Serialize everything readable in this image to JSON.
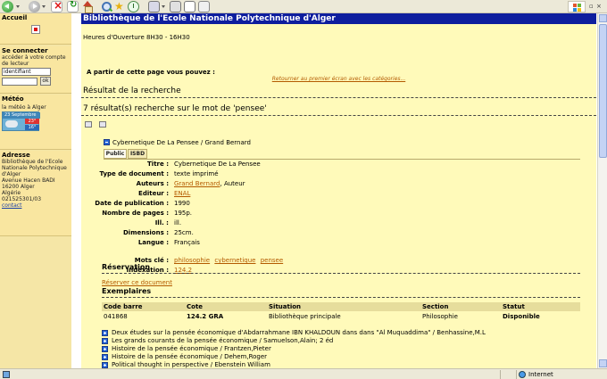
{
  "browser": {
    "zone": "Internet"
  },
  "sidebar": {
    "accueil": "Accueil",
    "login": {
      "heading": "Se connecter",
      "subtitle_line1": "accéder à votre compte",
      "subtitle_line2": "de lecteur",
      "username_value": "identifiant",
      "ok_label": "ok"
    },
    "meteo": {
      "heading": "Météo",
      "caption": "la météo à Alger",
      "date": "23 Septembre",
      "high": "23°",
      "low": "16°"
    },
    "adresse": {
      "heading": "Adresse",
      "lines": [
        "Bibliothèque de l'Ecole",
        "Nationale Polytechnique",
        "d'Alger",
        "Avenue Hacen BADI",
        "16200 Alger",
        "Algérie",
        "021525301/03"
      ],
      "contact": "contact"
    }
  },
  "main": {
    "banner": "Bibliothèque de l'Ecole Nationale Polytechnique d'Alger",
    "hours": "Heures d'Ouverture 8H30 - 16H30",
    "pv_label": "A partir de cette page vous pouvez :",
    "retour_link": "Retourner au premier écran avec les catégories...",
    "result_heading": "Résultat de la recherche",
    "result_count": "7 résultat(s) recherche sur le mot de 'pensee'",
    "notice": {
      "title": "Cybernetique De La Pensee / Grand Bernard",
      "tabs": [
        "Public",
        "ISBD"
      ],
      "fields": {
        "titre": {
          "label": "Titre :",
          "value": "Cybernetique De La Pensee"
        },
        "type": {
          "label": "Type de document :",
          "value": "texte imprimé"
        },
        "auteurs": {
          "label": "Auteurs :",
          "link": "Grand Bernard",
          "suffix": ", Auteur"
        },
        "editeur": {
          "label": "Editeur :",
          "link": "ENAL"
        },
        "date": {
          "label": "Date de publication :",
          "value": "1990"
        },
        "pages": {
          "label": "Nombre de pages :",
          "value": "195p."
        },
        "ill": {
          "label": "Ill. :",
          "value": "ill."
        },
        "dimensions": {
          "label": "Dimensions :",
          "value": "25cm."
        },
        "langue": {
          "label": "Langue :",
          "value": "Français"
        },
        "motscle": {
          "label": "Mots clé :",
          "links": [
            "philosophie",
            "cybernetique",
            "pensee"
          ]
        },
        "indexation": {
          "label": "Indexation :",
          "link": "124.2"
        }
      }
    },
    "reservation": {
      "heading": "Réservation",
      "link": "Réserver ce document"
    },
    "exemplaires": {
      "heading": "Exemplaires",
      "columns": [
        "Code barre",
        "Cote",
        "Situation",
        "Section",
        "Statut"
      ],
      "rows": [
        [
          "041868",
          "124.2 GRA",
          "Bibliothèque principale",
          "Philosophie",
          "Disponible"
        ]
      ]
    },
    "related": [
      "Deux études sur la pensée économique d'Abdarrahmane IBN KHALDOUN dans dans \"Al Muquaddima\" / Benhassine,M.L",
      "Les grands courants de la pensée économique / Samuelson,Alain; 2 éd",
      "Histoire de la pensée économique / Frantzen,Pieter",
      "Histoire de la pensée économique / Dehem,Roger",
      "Political thought in perspective / Ebenstein William"
    ]
  }
}
